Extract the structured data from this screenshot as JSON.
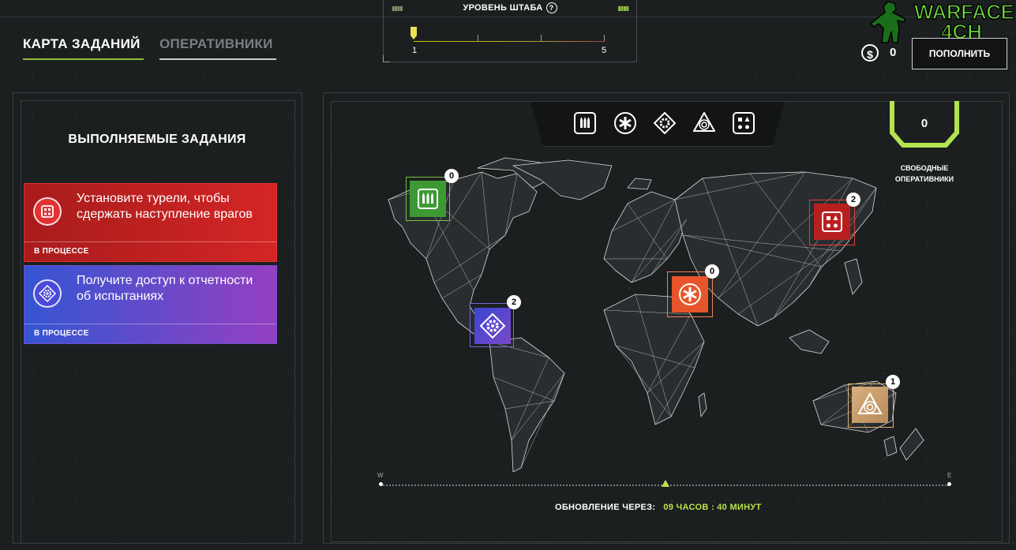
{
  "tabs": [
    {
      "label": "КАРТА ЗАДАНИЙ",
      "active": true
    },
    {
      "label": "ОПЕРАТИВНИКИ",
      "active": false
    }
  ],
  "hq": {
    "title": "УРОВЕНЬ ШТАБА",
    "help": "?",
    "min_label": "1",
    "max_label": "5",
    "current_level": 1
  },
  "logo": {
    "line1": "WARFACE",
    "line2": "4CH"
  },
  "currency": {
    "icon": "dollar-coin-icon",
    "symbol": "$",
    "value": "0"
  },
  "topup_label": "ПОПОЛНИТЬ",
  "left_panel": {
    "title": "ВЫПОЛНЯЕМЫЕ ЗАДАНИЯ",
    "quests": [
      {
        "text": "Установите турели, чтобы сдержать наступление врагов",
        "status": "В ПРОЦЕССЕ",
        "icon": "dice-icon",
        "color": "#c42020"
      },
      {
        "text": "Получите доступ к отчетности об испытаниях",
        "status": "В ПРОЦЕССЕ",
        "icon": "gear-icon",
        "color": "#6a4ac8"
      }
    ]
  },
  "filters": [
    {
      "name": "ammo-filter-icon"
    },
    {
      "name": "medic-filter-icon"
    },
    {
      "name": "engineer-filter-icon"
    },
    {
      "name": "sniper-filter-icon"
    },
    {
      "name": "dice-filter-icon"
    }
  ],
  "operatives": {
    "value": "0",
    "label_line1": "СВОБОДНЫЕ",
    "label_line2": "ОПЕРАТИВНИКИ"
  },
  "map_pins": [
    {
      "id": "north-america",
      "count": "0",
      "icon": "ammo-icon",
      "color": "#3d9a33"
    },
    {
      "id": "central-america",
      "count": "2",
      "icon": "gear-icon",
      "color": "#5a4ad0"
    },
    {
      "id": "middle-east",
      "count": "0",
      "icon": "medic-icon",
      "color": "#e85020"
    },
    {
      "id": "far-east",
      "count": "2",
      "icon": "dice-icon",
      "color": "#b82020"
    },
    {
      "id": "australia",
      "count": "1",
      "icon": "target-icon",
      "color": "#c8a070"
    }
  ],
  "timeline": {
    "west": "W",
    "east": "E"
  },
  "update": {
    "label": "ОБНОВЛЕНИЕ ЧЕРЕЗ:",
    "value": "09 ЧАСОВ : 40 МИНУТ"
  }
}
